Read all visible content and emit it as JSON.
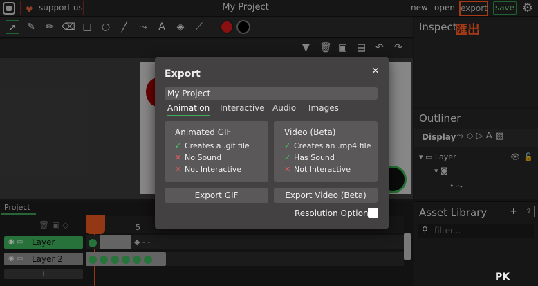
{
  "menubar": {
    "support_label": "support us",
    "project_title": "My Project",
    "new_label": "new",
    "open_label": "open",
    "export_label": "export",
    "save_label": "save"
  },
  "annotation": {
    "export_cn": "匯出"
  },
  "panels": {
    "inspector_title": "Inspect",
    "outliner_title": "Outliner",
    "outliner_display": "Display",
    "outliner_layer": "Layer",
    "asset_title": "Asset Library",
    "filter_placeholder": "filter..."
  },
  "timeline": {
    "tab_label": "Project",
    "frame_marker": "5",
    "layers": [
      "Layer",
      "Layer 2"
    ],
    "accent_color": "#3cae59"
  },
  "modal": {
    "title": "Export",
    "project_name": "My Project",
    "tabs": [
      "Animation",
      "Interactive",
      "Audio",
      "Images"
    ],
    "gif": {
      "title": "Animated GIF",
      "features": [
        {
          "ok": true,
          "text": "Creates a .gif file"
        },
        {
          "ok": false,
          "text": "No Sound"
        },
        {
          "ok": false,
          "text": "Not Interactive"
        }
      ],
      "button": "Export GIF"
    },
    "video": {
      "title": "Video (Beta)",
      "features": [
        {
          "ok": true,
          "text": "Creates an .mp4 file"
        },
        {
          "ok": true,
          "text": "Has Sound"
        },
        {
          "ok": false,
          "text": "Not Interactive"
        }
      ],
      "button": "Export Video (Beta)"
    },
    "resolution_label": "Resolution Options"
  },
  "watermark": "PK"
}
